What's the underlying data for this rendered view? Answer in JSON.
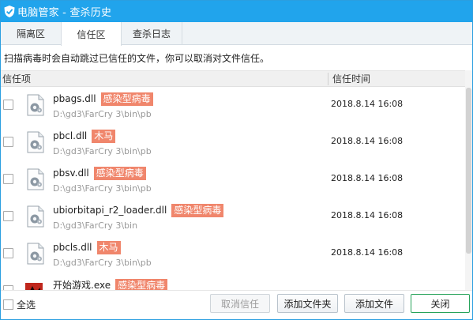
{
  "window": {
    "title": "电脑管家 - 查杀历史"
  },
  "tabs": [
    {
      "label": "隔离区",
      "active": false
    },
    {
      "label": "信任区",
      "active": true
    },
    {
      "label": "查杀日志",
      "active": false
    }
  ],
  "hint": "扫描病毒时会自动跳过已信任的文件，你可以取消对文件信任。",
  "columns": {
    "item": "信任项",
    "time": "信任时间"
  },
  "rows": [
    {
      "name": "pbags.dll",
      "tag": "感染型病毒",
      "path": "D:\\gd3\\FarCry 3\\bin\\pb",
      "time": "2018.8.14 16:08"
    },
    {
      "name": "pbcl.dll",
      "tag": "木马",
      "path": "D:\\gd3\\FarCry 3\\bin\\pb",
      "time": "2018.8.14 16:08"
    },
    {
      "name": "pbsv.dll",
      "tag": "感染型病毒",
      "path": "D:\\gd3\\FarCry 3\\bin\\pb",
      "time": "2018.8.14 16:08"
    },
    {
      "name": "ubiorbitapi_r2_loader.dll",
      "tag": "感染型病毒",
      "path": "D:\\gd3\\FarCry 3\\bin",
      "time": "2018.8.14 16:08"
    },
    {
      "name": "pbcls.dll",
      "tag": "木马",
      "path": "D:\\gd3\\FarCry 3\\bin\\pb",
      "time": "2018.8.14 16:08"
    },
    {
      "name": "开始游戏.exe",
      "tag": "感染型病毒",
      "path": "",
      "time": ""
    }
  ],
  "footer": {
    "select_all": "全选",
    "untrust": "取消信任",
    "add_folder": "添加文件夹",
    "add_file": "添加文件",
    "close": "关闭"
  },
  "colors": {
    "titlebar": "#21a4ec",
    "badge": "#f0866c",
    "primary_border": "#27a35a"
  }
}
